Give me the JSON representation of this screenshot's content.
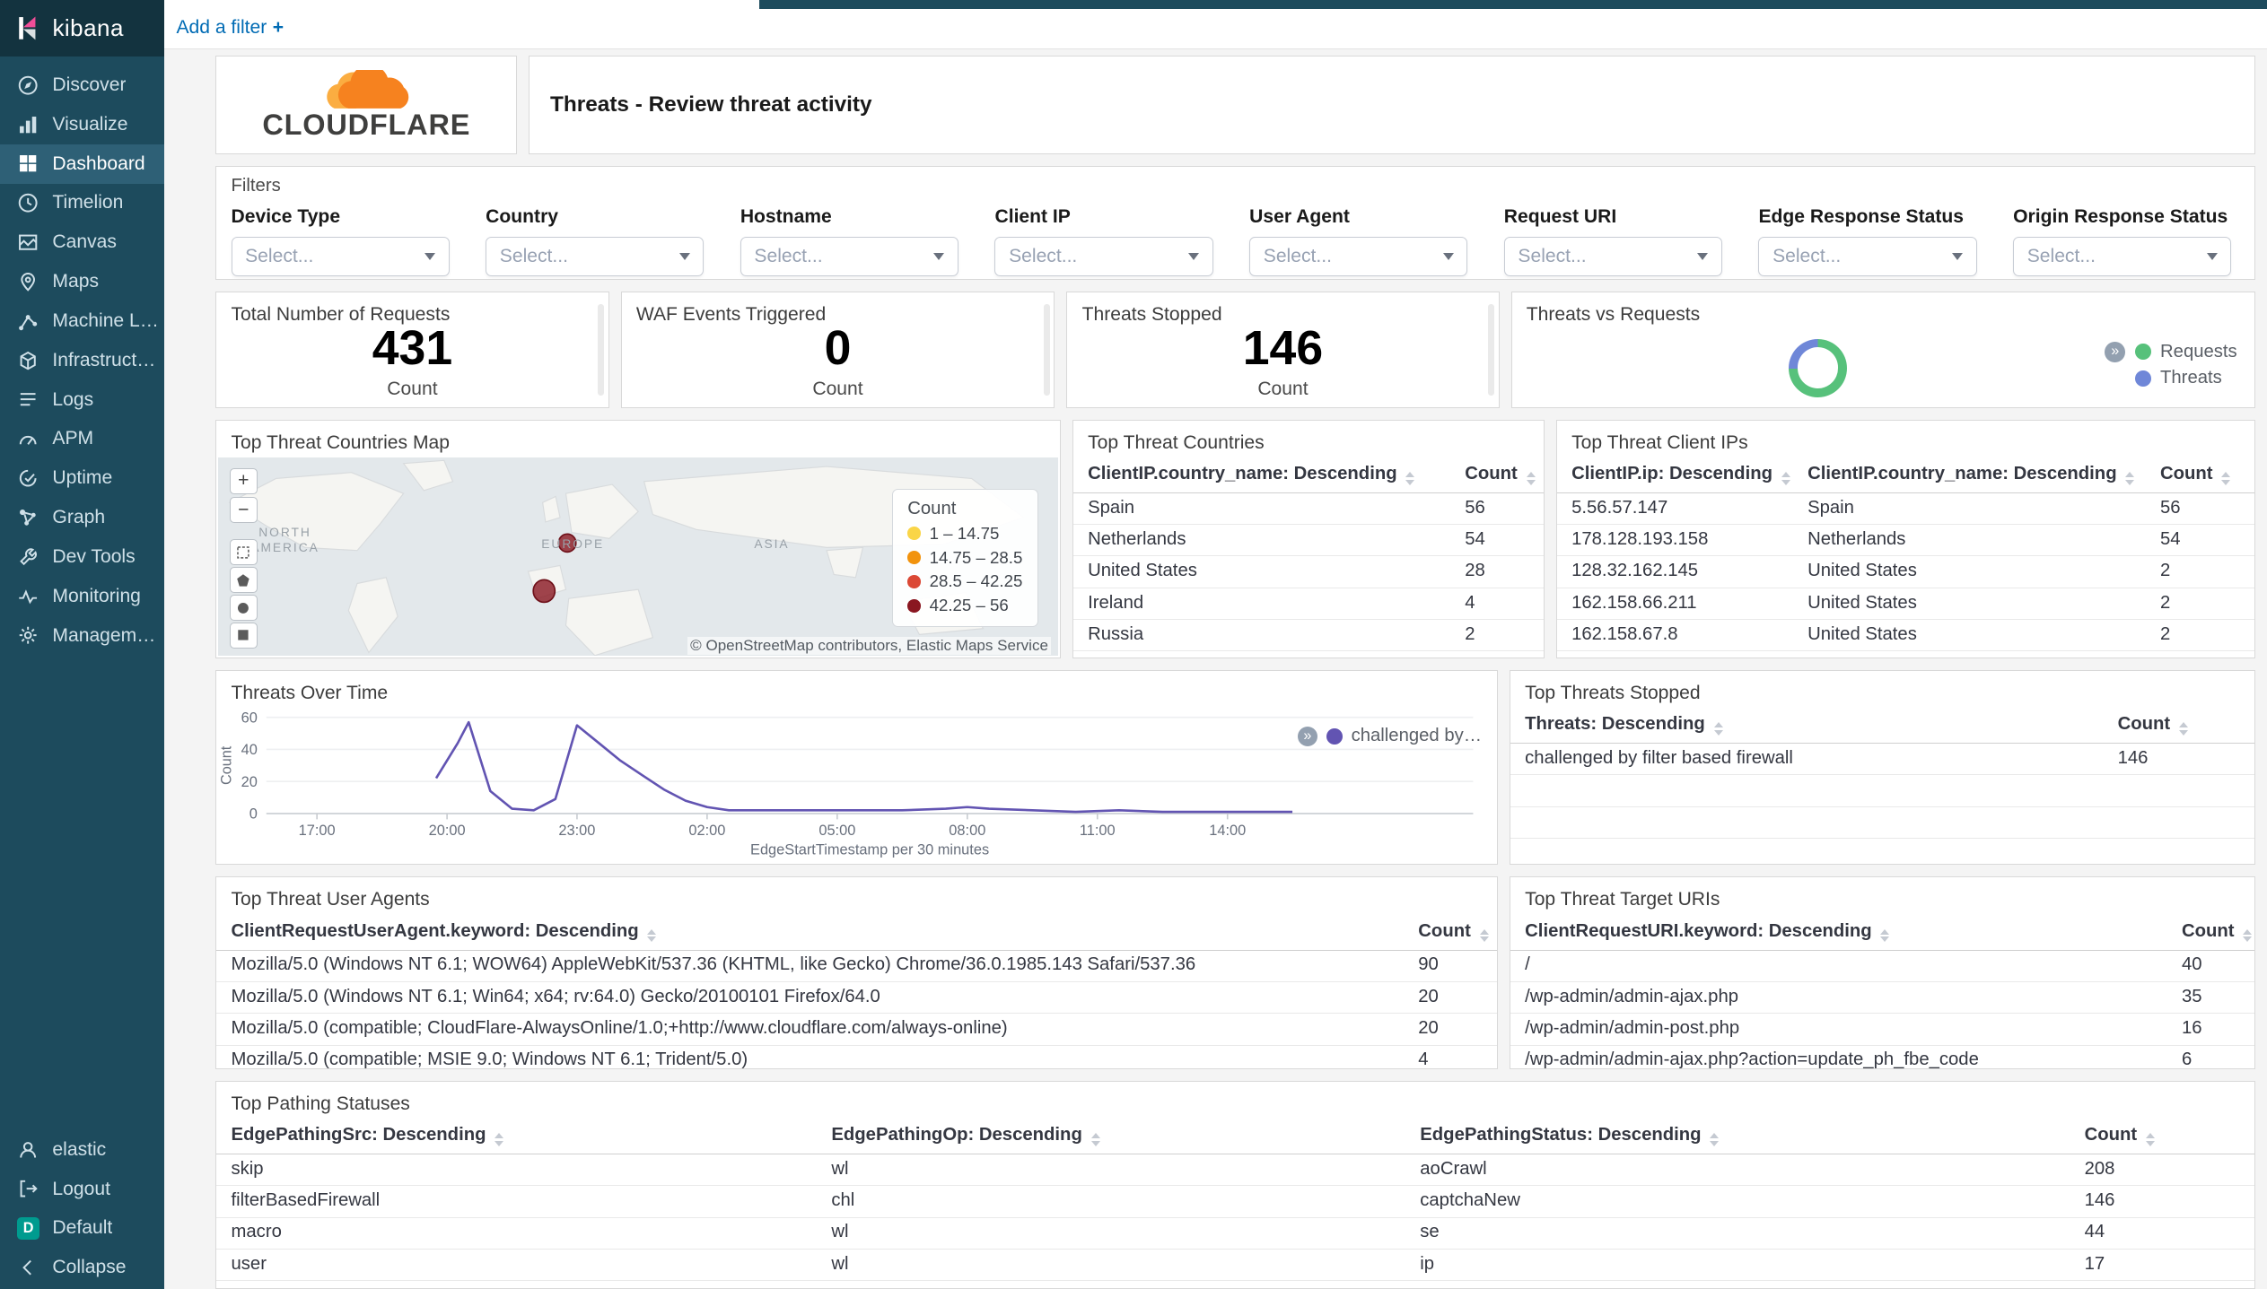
{
  "app": {
    "brand": "kibana"
  },
  "topbar": {
    "add_filter_label": "Add a filter"
  },
  "icons": {
    "legend_toggle": "»",
    "zoom_in": "+",
    "zoom_out": "−",
    "add_filter_plus": "+"
  },
  "sidebar": {
    "selected": "Dashboard",
    "items": [
      {
        "label": "Discover",
        "icon": "discover"
      },
      {
        "label": "Visualize",
        "icon": "visualize"
      },
      {
        "label": "Dashboard",
        "icon": "dashboard"
      },
      {
        "label": "Timelion",
        "icon": "timelion"
      },
      {
        "label": "Canvas",
        "icon": "canvas"
      },
      {
        "label": "Maps",
        "icon": "maps"
      },
      {
        "label": "Machine Learning",
        "icon": "machine-learning"
      },
      {
        "label": "Infrastructure",
        "icon": "infrastructure"
      },
      {
        "label": "Logs",
        "icon": "logs"
      },
      {
        "label": "APM",
        "icon": "apm"
      },
      {
        "label": "Uptime",
        "icon": "uptime"
      },
      {
        "label": "Graph",
        "icon": "graph"
      },
      {
        "label": "Dev Tools",
        "icon": "dev-tools"
      },
      {
        "label": "Monitoring",
        "icon": "monitoring"
      },
      {
        "label": "Management",
        "icon": "management"
      }
    ],
    "footer": [
      {
        "label": "elastic",
        "icon": "user"
      },
      {
        "label": "Logout",
        "icon": "logout"
      },
      {
        "label": "Default",
        "icon": "space-default",
        "badge": "D"
      },
      {
        "label": "Collapse",
        "icon": "collapse"
      }
    ]
  },
  "header": {
    "logo_text": "CLOUDFLARE",
    "markdown_title": "Threats - Review threat activity"
  },
  "filters": {
    "title": "Filters",
    "placeholder": "Select...",
    "fields": [
      "Device Type",
      "Country",
      "Hostname",
      "Client IP",
      "User Agent",
      "Request URI",
      "Edge Response Status",
      "Origin Response Status"
    ]
  },
  "metrics": [
    {
      "title": "Total Number of Requests",
      "value": "431",
      "label": "Count"
    },
    {
      "title": "WAF Events Triggered",
      "value": "0",
      "label": "Count"
    },
    {
      "title": "Threats Stopped",
      "value": "146",
      "label": "Count"
    }
  ],
  "map": {
    "title": "Top Threat Countries Map",
    "labels": [
      "NORTH AMERICA",
      "EUROPE",
      "ASIA"
    ],
    "legend_title": "Count",
    "legend_classes": [
      {
        "label": "1 – 14.75",
        "color": "#FAD547"
      },
      {
        "label": "14.75 – 28.5",
        "color": "#F2930D"
      },
      {
        "label": "28.5 – 42.25",
        "color": "#DB4835"
      },
      {
        "label": "42.25 – 56",
        "color": "#8A1721"
      }
    ],
    "points": [
      {
        "label": "Netherlands",
        "value": 54
      },
      {
        "label": "Spain",
        "value": 56
      }
    ],
    "attribution": "© OpenStreetMap contributors, Elastic Maps Service"
  },
  "chart_data": [
    {
      "type": "pie",
      "donut": true,
      "title": "Threats vs Requests",
      "labels": [
        "Requests",
        "Threats"
      ],
      "values": [
        431,
        146
      ],
      "colors": [
        "#57C17B",
        "#6F87D8"
      ],
      "legend_position": "right"
    },
    {
      "type": "line",
      "title": "Threats Over Time",
      "xlabel": "EdgeStartTimestamp per 30 minutes",
      "ylabel": "Count",
      "ylim": [
        0,
        60
      ],
      "yticks": [
        0,
        20,
        40,
        60
      ],
      "xticks": [
        "17:00",
        "20:00",
        "23:00",
        "02:00",
        "05:00",
        "08:00",
        "11:00",
        "14:00"
      ],
      "legend_position": "right",
      "series": [
        {
          "name": "challenged by filter based firewall",
          "color": "#6254B2",
          "points": [
            [
              "19:45",
              22
            ],
            [
              "20:15",
              44
            ],
            [
              "20:30",
              57
            ],
            [
              "21:00",
              14
            ],
            [
              "21:30",
              3
            ],
            [
              "22:00",
              2
            ],
            [
              "22:30",
              9
            ],
            [
              "23:00",
              55
            ],
            [
              "23:30",
              44
            ],
            [
              "00:00",
              33
            ],
            [
              "00:30",
              24
            ],
            [
              "01:00",
              15
            ],
            [
              "01:30",
              8
            ],
            [
              "02:00",
              4
            ],
            [
              "02:30",
              2
            ],
            [
              "03:30",
              2
            ],
            [
              "04:30",
              2
            ],
            [
              "05:30",
              2
            ],
            [
              "06:30",
              2
            ],
            [
              "07:30",
              3
            ],
            [
              "08:00",
              4
            ],
            [
              "08:30",
              3
            ],
            [
              "09:30",
              2
            ],
            [
              "10:30",
              1
            ],
            [
              "11:30",
              2
            ],
            [
              "12:30",
              1
            ],
            [
              "13:30",
              1
            ],
            [
              "14:30",
              1
            ],
            [
              "15:30",
              1
            ]
          ]
        }
      ]
    }
  ],
  "tables": {
    "countries": {
      "title": "Top Threat Countries",
      "columns": [
        "ClientIP.country_name: Descending",
        "Count"
      ],
      "rows": [
        [
          "Spain",
          "56"
        ],
        [
          "Netherlands",
          "54"
        ],
        [
          "United States",
          "28"
        ],
        [
          "Ireland",
          "4"
        ],
        [
          "Russia",
          "2"
        ]
      ]
    },
    "client_ips": {
      "title": "Top Threat Client IPs",
      "columns": [
        "ClientIP.ip: Descending",
        "ClientIP.country_name: Descending",
        "Count"
      ],
      "rows": [
        [
          "5.56.57.147",
          "Spain",
          "56"
        ],
        [
          "178.128.193.158",
          "Netherlands",
          "54"
        ],
        [
          "128.32.162.145",
          "United States",
          "2"
        ],
        [
          "162.158.66.211",
          "United States",
          "2"
        ],
        [
          "162.158.67.8",
          "United States",
          "2"
        ]
      ]
    },
    "threats_stopped": {
      "title": "Top Threats Stopped",
      "columns": [
        "Threats: Descending",
        "Count"
      ],
      "rows": [
        [
          "challenged by filter based firewall",
          "146"
        ]
      ]
    },
    "user_agents": {
      "title": "Top Threat User Agents",
      "columns": [
        "ClientRequestUserAgent.keyword: Descending",
        "Count"
      ],
      "rows": [
        [
          "Mozilla/5.0 (Windows NT 6.1; WOW64) AppleWebKit/537.36 (KHTML, like Gecko) Chrome/36.0.1985.143 Safari/537.36",
          "90"
        ],
        [
          "Mozilla/5.0 (Windows NT 6.1; Win64; x64; rv:64.0) Gecko/20100101 Firefox/64.0",
          "20"
        ],
        [
          "Mozilla/5.0 (compatible; CloudFlare-AlwaysOnline/1.0;+http://www.cloudflare.com/always-online)",
          "20"
        ],
        [
          "Mozilla/5.0 (compatible; MSIE 9.0; Windows NT 6.1; Trident/5.0)",
          "4"
        ]
      ]
    },
    "target_uris": {
      "title": "Top Threat Target URIs",
      "columns": [
        "ClientRequestURI.keyword: Descending",
        "Count"
      ],
      "rows": [
        [
          "/",
          "40"
        ],
        [
          "/wp-admin/admin-ajax.php",
          "35"
        ],
        [
          "/wp-admin/admin-post.php",
          "16"
        ],
        [
          "/wp-admin/admin-ajax.php?action=update_ph_fbe_code",
          "6"
        ]
      ]
    },
    "pathing": {
      "title": "Top Pathing Statuses",
      "columns": [
        "EdgePathingSrc: Descending",
        "EdgePathingOp: Descending",
        "EdgePathingStatus: Descending",
        "Count"
      ],
      "rows": [
        [
          "skip",
          "wl",
          "aoCrawl",
          "208"
        ],
        [
          "filterBasedFirewall",
          "chl",
          "captchaNew",
          "146"
        ],
        [
          "macro",
          "wl",
          "se",
          "44"
        ],
        [
          "user",
          "wl",
          "ip",
          "17"
        ]
      ]
    }
  }
}
